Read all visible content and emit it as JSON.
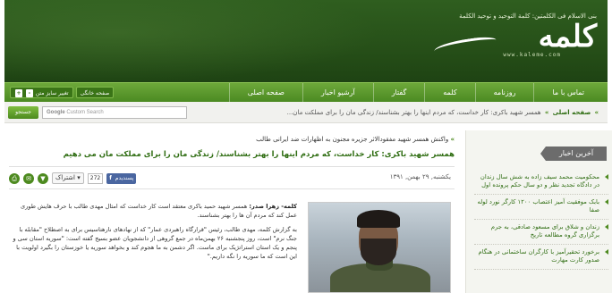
{
  "header": {
    "tagline": "بنی الاسلام فی الکلمتین: کلمة التوحید و توحید الکلمة",
    "logo_text": "کلمه",
    "url": "www.kaleme.com"
  },
  "nav": {
    "items": [
      "صفحه اصلی",
      "آرشیو اخبار",
      "گفتار",
      "کلمه",
      "روزنامه",
      "تماس با ما"
    ],
    "tools": {
      "home_label": "صفحه خانگی",
      "font_size_label": "تغییر سایز متن",
      "plus": "+",
      "minus": "-"
    }
  },
  "subbar": {
    "search_button": "جستجو",
    "search_google": "Google",
    "search_placeholder": "Custom Search",
    "breadcrumb_home": "صفحه اصلی",
    "breadcrumb_arrow": "»",
    "breadcrumb_path": "همسر شهید باکری: کار خداست، که مردم اینها را بهتر بشناسند/ زندگی مان را برای مملکت مان..."
  },
  "article": {
    "parent_arrow": "»",
    "parent_link": "واکنش همسر شهید مفقودالاثر جزیره مجنون به اظهارات ضد ایرانی طالب",
    "title": "همسر شهید باکری: کار خداست، که مردم اینها را بهتر بشناسند/ زندگی مان را برای مملکت مان می دهیم",
    "date": "یکشنبه, ۲۹ بهمن, ۱۳۹۱",
    "share_label": "اشتراک",
    "share_caret": "▾",
    "share_count": "272",
    "like_label": "پسندیدم",
    "like_f": "f",
    "lead_label": "کلمه- زهرا صدر:",
    "paragraph_1": "همسر شهید حمید باکری معتقد است کار خداست که امثال مهدی طالب با حرف هایش طوری عمل کند که مردم آن ها را بهتر بشناسند.",
    "paragraph_2": "به گزارش کلمه، مهدی طالب، رئیس \"قرارگاه راهبردی عمار\" که از نهادهای نارهتاسیس برای به اصطلاح \"مقابله با جنگ نرم\" است، روز پنجشنبه ۲۶ بهمن‌ماه در جمع گروهی از دانشجویان عضو بسیج گفته است: \"سوریه استان سی و پنجم و یک استان استراتژیک برای ماست. اگر دشمن به ما هجوم کند و بخواهد سوریه یا خوزستان را بگیرد اولویت با این است که ما سوریه را نگه داریم.\""
  },
  "sidebar": {
    "title": "آخرین اخبار",
    "items": [
      "محکومیت محمد سیف زاده به شش سال زندان در دادگاه تجدید نظر و دو سال حکم پرونده اول",
      "بابک موفقیت آمیز اعتصاب ۱۲۰۰ کارگر نورد لوله صفا",
      "زندان و شلاق برای مسعود صادقی، به جرم برگزاری گروه مطالعه تاریخ",
      "برخورد تحقیرآمیز با کارگران ساختمانی در هنگام صدور کارت مهارت"
    ]
  },
  "colors": {
    "header_green": "#2f5e1f",
    "nav_green": "#5a9a2c",
    "title_green": "#2f6d12",
    "sidebar_title_bg": "#6c6c6c"
  }
}
